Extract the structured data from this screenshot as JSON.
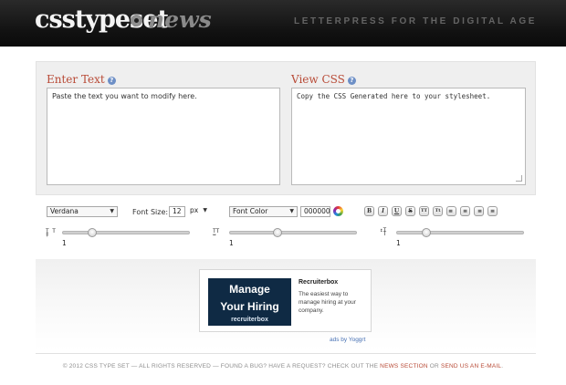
{
  "header": {
    "logo": "csstypeset",
    "logo_suffix": "news",
    "tagline": "LETTERPRESS FOR THE DIGITAL AGE"
  },
  "editor": {
    "enter_title": "Enter Text",
    "enter_placeholder": "Paste the text you want to modify here.",
    "view_title": "View CSS",
    "view_placeholder": "Copy the CSS Generated here to your stylesheet.",
    "help_glyph": "?"
  },
  "controls": {
    "font_family": "Verdana",
    "font_size_label": "Font Size:",
    "font_size_value": "12",
    "font_size_unit": "px",
    "font_color_label": "Font Color",
    "font_color_value": "000000",
    "format_buttons": [
      "B",
      "I",
      "U",
      "S",
      "TT",
      "Tt",
      "≡",
      "≡",
      "≡",
      "≡"
    ],
    "sliders": [
      {
        "name": "line-height",
        "value": "1",
        "position": 0.23
      },
      {
        "name": "letter-spacing",
        "value": "1",
        "position": 0.38
      },
      {
        "name": "word-spacing",
        "value": "1",
        "position": 0.23
      }
    ]
  },
  "ad": {
    "image_line1": "Manage",
    "image_line2": "Your Hiring",
    "image_brand": "recruiterbox",
    "title": "Recruiterbox",
    "description": "The easiest way to manage hiring at your company.",
    "credit": "ads by Yoggrt"
  },
  "footer": {
    "text": "© 2012 CSS TYPE SET — ALL RIGHTS RESERVED — FOUND A BUG? HAVE A REQUEST? CHECK OUT THE",
    "news_link": "NEWS SECTION",
    "or": "OR",
    "email_link": "SEND US AN E-MAIL",
    "end": "."
  },
  "colors": {
    "accent": "#b84a36",
    "header_bg": "#111111",
    "ad_bg": "#0f2a44",
    "link": "#4a73b5"
  }
}
